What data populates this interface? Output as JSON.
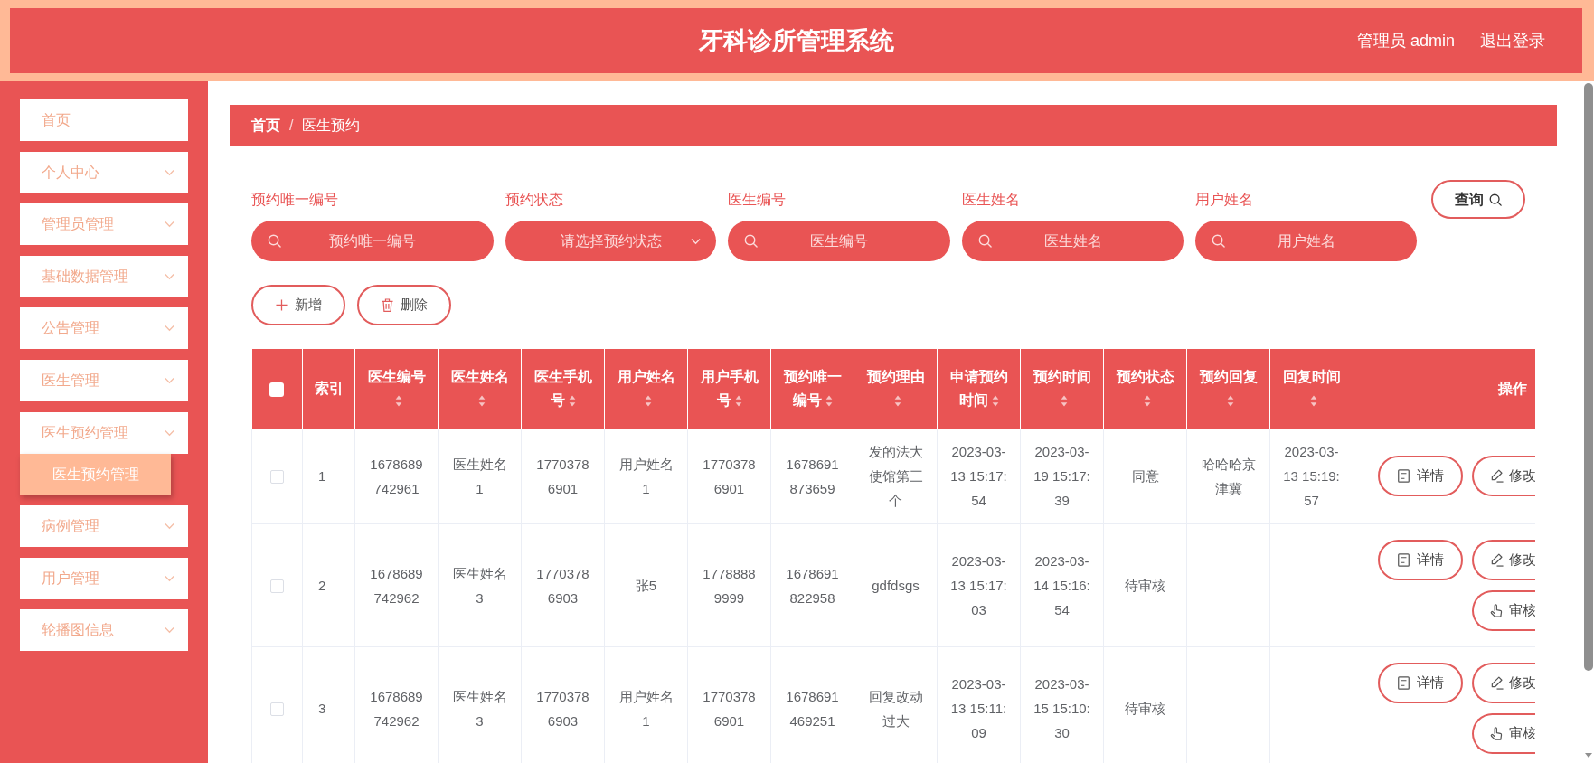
{
  "header": {
    "title": "牙科诊所管理系统",
    "user": "管理员 admin",
    "logout": "退出登录"
  },
  "sidebar": {
    "items": [
      {
        "label": "首页",
        "kind": "link"
      },
      {
        "label": "个人中心",
        "kind": "submenu"
      },
      {
        "label": "管理员管理",
        "kind": "submenu"
      },
      {
        "label": "基础数据管理",
        "kind": "submenu"
      },
      {
        "label": "公告管理",
        "kind": "submenu"
      },
      {
        "label": "医生管理",
        "kind": "submenu"
      },
      {
        "label": "医生预约管理",
        "kind": "submenu",
        "children": [
          {
            "label": "医生预约管理",
            "selected": true
          }
        ]
      },
      {
        "label": "病例管理",
        "kind": "submenu"
      },
      {
        "label": "用户管理",
        "kind": "submenu"
      },
      {
        "label": "轮播图信息",
        "kind": "submenu"
      }
    ]
  },
  "breadcrumb": {
    "separator": "/",
    "items": [
      {
        "label": "首页",
        "current": false
      },
      {
        "label": "医生预约",
        "current": true
      }
    ]
  },
  "filters": [
    {
      "label": "预约唯一编号",
      "kind": "text",
      "placeholder": "预约唯一编号"
    },
    {
      "label": "预约状态",
      "kind": "select",
      "placeholder": "请选择预约状态"
    },
    {
      "label": "医生编号",
      "kind": "text",
      "placeholder": "医生编号"
    },
    {
      "label": "医生姓名",
      "kind": "text",
      "placeholder": "医生姓名"
    },
    {
      "label": "用户姓名",
      "kind": "text",
      "placeholder": "用户姓名"
    }
  ],
  "search_button": "查询",
  "actions": [
    {
      "label": "新增",
      "kind": "add"
    },
    {
      "label": "删除",
      "kind": "delete"
    }
  ],
  "table": {
    "all_checked": false,
    "columns": [
      {
        "label": "索引",
        "sortable": false
      },
      {
        "label": "医生编号",
        "sortable": true
      },
      {
        "label": "医生姓名",
        "sortable": true
      },
      {
        "label": "医生手机号",
        "sortable": true
      },
      {
        "label": "用户姓名",
        "sortable": true
      },
      {
        "label": "用户手机号",
        "sortable": true
      },
      {
        "label": "预约唯一编号",
        "sortable": true
      },
      {
        "label": "预约理由",
        "sortable": true
      },
      {
        "label": "申请预约时间",
        "sortable": true
      },
      {
        "label": "预约时间",
        "sortable": true
      },
      {
        "label": "预约状态",
        "sortable": true
      },
      {
        "label": "预约回复",
        "sortable": true
      },
      {
        "label": "回复时间",
        "sortable": true
      },
      {
        "label": "操作",
        "sortable": false
      }
    ],
    "rows": [
      {
        "checked": false,
        "index": "1",
        "doctor_no": "1678689742961",
        "doctor_name": "医生姓名1",
        "doctor_phone": "17703786901",
        "user_name": "用户姓名1",
        "user_phone": "17703786901",
        "booking_no": "1678691873659",
        "reason": "发的法大使馆第三个",
        "applied_at": "2023-03-13 15:17:54",
        "booking_time": "2023-03-19 15:17:39",
        "status": "同意",
        "reply": "哈哈哈京津冀",
        "reply_time": "2023-03-13 15:19:57",
        "buttons": [
          {
            "label": "详情",
            "kind": "detail"
          },
          {
            "label": "修改",
            "kind": "edit"
          }
        ]
      },
      {
        "checked": false,
        "index": "2",
        "doctor_no": "1678689742962",
        "doctor_name": "医生姓名3",
        "doctor_phone": "17703786903",
        "user_name": "张5",
        "user_phone": "17788889999",
        "booking_no": "1678691822958",
        "reason": "gdfdsgs",
        "applied_at": "2023-03-13 15:17:03",
        "booking_time": "2023-03-14 15:16:54",
        "status": "待审核",
        "buttons": [
          {
            "label": "详情",
            "kind": "detail"
          },
          {
            "label": "修改",
            "kind": "edit"
          },
          {
            "label": "审核",
            "kind": "review"
          }
        ]
      },
      {
        "checked": false,
        "index": "3",
        "doctor_no": "1678689742962",
        "doctor_name": "医生姓名3",
        "doctor_phone": "17703786903",
        "user_name": "用户姓名1",
        "user_phone": "17703786901",
        "booking_no": "1678691469251",
        "reason": "回复改动过大",
        "applied_at": "2023-03-13 15:11:09",
        "booking_time": "2023-03-15 15:10:30",
        "status": "待审核",
        "buttons": [
          {
            "label": "详情",
            "kind": "detail"
          },
          {
            "label": "修改",
            "kind": "edit"
          },
          {
            "label": "审核",
            "kind": "review"
          }
        ]
      }
    ]
  }
}
